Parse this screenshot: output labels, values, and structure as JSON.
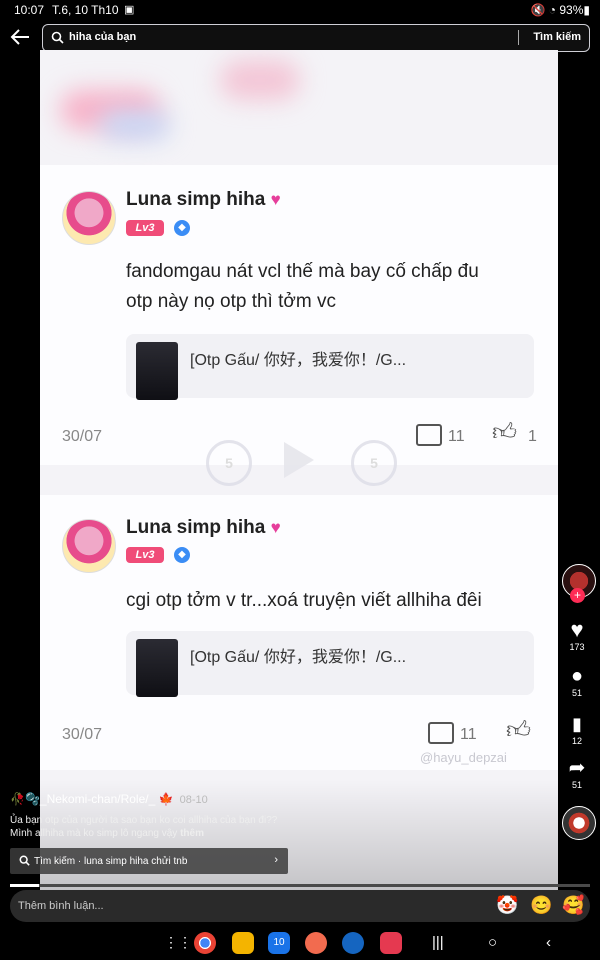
{
  "status_bar": {
    "time": "10:07",
    "date": "T.6, 10 Th10",
    "battery": "93%"
  },
  "search": {
    "query": "hiha của bạn",
    "button": "Tìm kiếm"
  },
  "comments": [
    {
      "username": "Luna simp hiha",
      "level": "Lv3",
      "text_line1": "fandomgau nát vcl thế mà bay cố chấp đu",
      "text_line2": "otp này nọ otp thì tởm vc",
      "quote": "[Otp Gấu/ 你好，我爱你！/G...",
      "date": "30/07",
      "comment_count": "11",
      "like_count": "1"
    },
    {
      "username": "Luna simp hiha",
      "level": "Lv3",
      "text_line1": "cgi otp tởm v tr...xoá truyện viết allhiha đêi",
      "quote": "[Otp Gấu/ 你好，我爱你！/G...",
      "date": "30/07",
      "comment_count": "11"
    }
  ],
  "watermark": "@hayu_depzai",
  "rail": {
    "likes": "173",
    "comments": "51",
    "saves": "12",
    "shares": "51"
  },
  "post": {
    "author": "_Nekomi-chan/Role/_",
    "author_date": "08-10",
    "description": "Ủa bạn otp của người ta sao bạn ko coi allhiha của bạn đi?? Mình allhiha mà ko simp lô ngang vậy",
    "more_label": "thêm",
    "suggestion": "Tìm kiếm · luna simp hiha chửi tnb",
    "progress": 0.05
  },
  "comment_input": {
    "placeholder": "Thêm bình luận..."
  }
}
